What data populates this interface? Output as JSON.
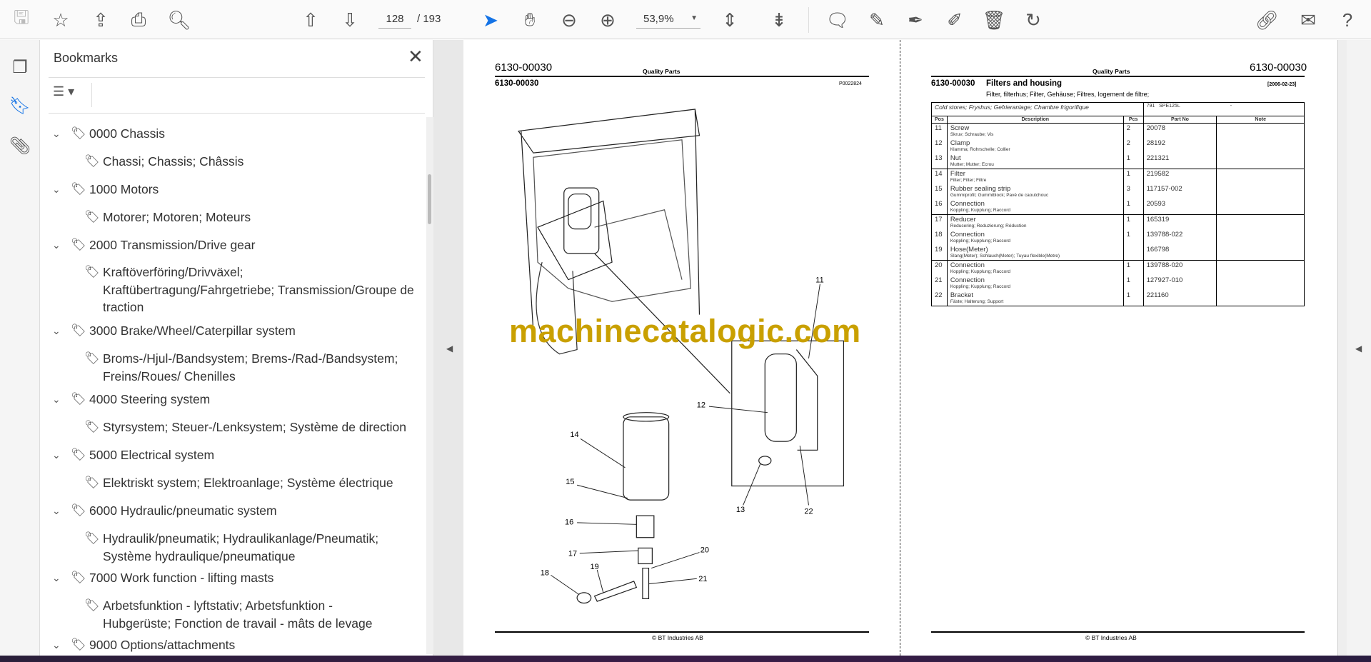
{
  "toolbar": {
    "icons": [
      "save-icon",
      "bookmark-star-icon",
      "upload-icon",
      "print-icon",
      "find-icon",
      "page-up-icon",
      "page-down-icon",
      "select-cursor-icon",
      "hand-icon",
      "zoom-out-icon",
      "zoom-in-icon",
      "fit-page-icon",
      "scroll-mode-icon",
      "comment-icon",
      "highlight-icon",
      "sign-icon",
      "edit-pdf-icon",
      "delete-icon",
      "rotate-icon",
      "share-link-icon",
      "email-icon",
      "help-icon"
    ],
    "page_current": "128",
    "page_total": "/ 193",
    "zoom": "53,9%"
  },
  "bookmarks": {
    "title": "Bookmarks",
    "items": [
      {
        "label": "0000 Chassis",
        "level": 0
      },
      {
        "label": "Chassi; Chassis; Châssis",
        "level": 1
      },
      {
        "label": "1000 Motors",
        "level": 0
      },
      {
        "label": "Motorer; Motoren; Moteurs",
        "level": 1
      },
      {
        "label": "2000 Transmission/Drive gear",
        "level": 0
      },
      {
        "label": "Kraftöverföring/Drivväxel;",
        "label2": "Kraftübertragung/Fahrgetriebe; Transmission/Groupe de",
        "label3": "traction",
        "level": 1
      },
      {
        "label": "3000 Brake/Wheel/Caterpillar system",
        "level": 0
      },
      {
        "label": "Broms-/Hjul-/Bandsystem; Brems-/Rad-/Bandsystem;",
        "label2": "Freins/Roues/ Chenilles",
        "level": 1
      },
      {
        "label": "4000 Steering system",
        "level": 0
      },
      {
        "label": "Styrsystem; Steuer-/Lenksystem; Système de direction",
        "level": 1
      },
      {
        "label": "5000 Electrical system",
        "level": 0
      },
      {
        "label": "Elektriskt system; Elektroanlage; Système électrique",
        "level": 1
      },
      {
        "label": "6000 Hydraulic/pneumatic system",
        "level": 0
      },
      {
        "label": "Hydraulik/pneumatik; Hydraulikanlage/Pneumatik;",
        "label2": "Système hydraulique/pneumatique",
        "level": 1
      },
      {
        "label": "7000 Work function - lifting masts",
        "level": 0
      },
      {
        "label": "Arbetsfunktion - lyftstativ; Arbetsfunktion -",
        "label2": "Hubgerüste; Fonction de travail - mâts de levage",
        "level": 1
      },
      {
        "label": "9000 Options/attachments",
        "level": 0
      }
    ]
  },
  "left_page": {
    "code_top": "6130-00030",
    "header": "Quality Parts",
    "code": "6130-00030",
    "drawing_no": "P0022824",
    "callouts": [
      "11",
      "12",
      "13",
      "14",
      "15",
      "16",
      "17",
      "18",
      "19",
      "20",
      "21",
      "22"
    ],
    "watermark": "machinecatalogic.com",
    "footer": "© BT Industries AB"
  },
  "right_page": {
    "header": "Quality Parts",
    "code_top": "6130-00030",
    "code": "6130-00030",
    "title": "Filters and housing",
    "subtitle": "Filter, filterhus; Filter, Gehäuse; Filtres, logement de filtre;",
    "date": "[2006-02-23]",
    "caption": "Cold stores; Fryshus; Gefrieranlage; Chambre frigorifique",
    "model_no": "791",
    "model": "SPE125L",
    "model_dash": "-",
    "columns": [
      "Pos",
      "Description",
      "Pcs",
      "Part No",
      "Note"
    ],
    "rows": [
      {
        "pos": "11",
        "desc": "Screw",
        "sub": "Skruv; Schraube; Vis",
        "pcs": "2",
        "part": "20078",
        "group_start": true
      },
      {
        "pos": "12",
        "desc": "Clamp",
        "sub": "Klamma; Rohrschelle; Collier",
        "pcs": "2",
        "part": "28192"
      },
      {
        "pos": "13",
        "desc": "Nut",
        "sub": "Mutter; Mutter; Ecrou",
        "pcs": "1",
        "part": "221321"
      },
      {
        "pos": "14",
        "desc": "Filter",
        "sub": "Filter; Filter; Filtre",
        "pcs": "1",
        "part": "219582",
        "group_start": true
      },
      {
        "pos": "15",
        "desc": "Rubber sealing strip",
        "sub": "Gummiprofil; Gummiblock; Pavé de caoutchouc",
        "pcs": "3",
        "part": "117157-002"
      },
      {
        "pos": "16",
        "desc": "Connection",
        "sub": "Koppling; Kupplung; Raccord",
        "pcs": "1",
        "part": "20593"
      },
      {
        "pos": "17",
        "desc": "Reducer",
        "sub": "Reducering; Reduzierung; Réduction",
        "pcs": "1",
        "part": "165319",
        "group_start": true
      },
      {
        "pos": "18",
        "desc": "Connection",
        "sub": "Koppling; Kupplung; Raccord",
        "pcs": "1",
        "part": "139788-022"
      },
      {
        "pos": "19",
        "desc": "Hose(Meter)",
        "sub": "Slang(Meter); Schlauch(Meter); Tuyau flexible(Metre)",
        "pcs": "",
        "part": "166798"
      },
      {
        "pos": "20",
        "desc": "Connection",
        "sub": "Koppling; Kupplung; Raccord",
        "pcs": "1",
        "part": "139788-020",
        "group_start": true
      },
      {
        "pos": "21",
        "desc": "Connection",
        "sub": "Koppling; Kupplung; Raccord",
        "pcs": "1",
        "part": "127927-010"
      },
      {
        "pos": "22",
        "desc": "Bracket",
        "sub": "Fäste; Halterung; Support",
        "pcs": "1",
        "part": "221160"
      }
    ],
    "footer": "© BT Industries AB"
  }
}
